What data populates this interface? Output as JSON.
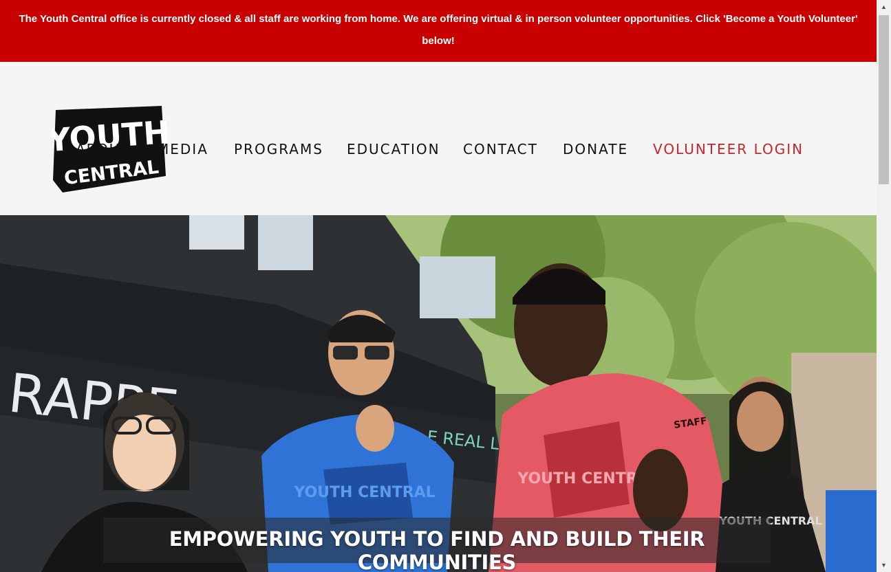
{
  "banner": {
    "text": "The Youth Central office is currently closed & all staff are working from home. We are offering virtual & in person volunteer opportunities. Click 'Become a Youth Volunteer' below!"
  },
  "logo": {
    "line1": "YOUTH",
    "line2": "CENTRAL"
  },
  "nav": {
    "items": [
      {
        "label": "ABOUT"
      },
      {
        "label": "MEDIA"
      },
      {
        "label": "PROGRAMS"
      },
      {
        "label": "EDUCATION"
      },
      {
        "label": "CONTACT"
      },
      {
        "label": "DONATE"
      },
      {
        "label": "VOLUNTEER LOGIN"
      }
    ],
    "dropdown_glyph": "▾"
  },
  "hero": {
    "caption": "EMPOWERING YOUTH TO FIND AND BUILD THEIR COMMUNITIES",
    "shirt_text": "YOUTH CENTRAL",
    "staff_label": "STAFF",
    "store_sign": "RAPPE",
    "store_tagline": "E REAL LIFE"
  },
  "colors": {
    "banner_bg": "#c80000",
    "accent": "#c9242b",
    "header_bg": "#f5f5f5"
  },
  "scrollbar": {
    "up_icon": "▲",
    "down_icon": "▼"
  }
}
